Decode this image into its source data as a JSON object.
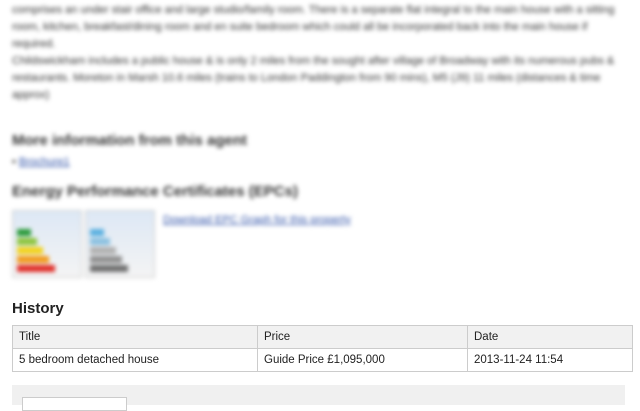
{
  "description": {
    "paragraph1": "comprises an under stair office and large studio/family room. There is a separate flat integral to the main house with a sitting room, kitchen, breakfast/dining room and en suite bedroom which could all be incorporated back into the main house if required.",
    "paragraph2": "Childswickham includes a public house & is only 2 miles from the sought after village of Broadway with its numerous pubs & restaurants. Moreton in Marsh 10.6 miles (trains to London Paddington from 90 mins), M5 (J9) 11 miles (distances & time approx)"
  },
  "agent": {
    "heading": "More information from this agent",
    "links": [
      "Brochure1"
    ]
  },
  "epc": {
    "heading": "Energy Performance Certificates (EPCs)",
    "download_link": "Download EPC Graph for this property"
  },
  "history": {
    "heading": "History",
    "columns": [
      "Title",
      "Price",
      "Date"
    ],
    "rows": [
      [
        "5 bedroom detached house",
        "Guide Price £1,095,000",
        "2013-11-24 11:54"
      ]
    ]
  }
}
